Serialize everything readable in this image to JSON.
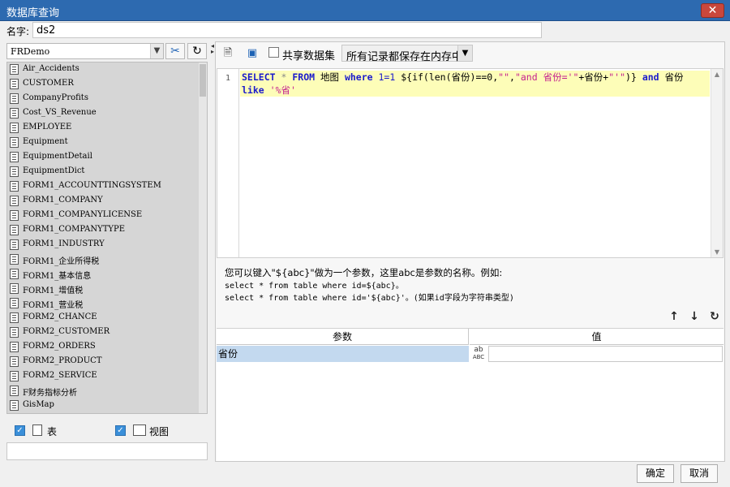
{
  "window": {
    "title": "数据库查询",
    "close_label": "✕"
  },
  "name_field": {
    "label": "名字:",
    "value": "ds2"
  },
  "left": {
    "connection": "FRDemo",
    "tables": [
      "Air_Accidents",
      "CUSTOMER",
      "CompanyProfits",
      "Cost_VS_Revenue",
      "EMPLOYEE",
      "Equipment",
      "EquipmentDetail",
      "EquipmentDict",
      "FORM1_ACCOUNTTINGSYSTEM",
      "FORM1_COMPANY",
      "FORM1_COMPANYLICENSE",
      "FORM1_COMPANYTYPE",
      "FORM1_INDUSTRY",
      "FORM1_企业所得税",
      "FORM1_基本信息",
      "FORM1_增值税",
      "FORM1_营业税",
      "FORM2_CHANCE",
      "FORM2_CUSTOMER",
      "FORM2_ORDERS",
      "FORM2_PRODUCT",
      "FORM2_SERVICE",
      "F财务指标分析",
      "GisMap"
    ],
    "filter_table_label": "表",
    "filter_view_label": "视图"
  },
  "right": {
    "share_label": "共享数据集",
    "storage_option": "所有记录都保存在内存中",
    "line_number": "1",
    "sql": {
      "t1": "SELECT",
      "t2": "*",
      "t3": "FROM",
      "t4": "地图",
      "t5": "where",
      "t6": "1=1",
      "t7": "${if(len(省份)==0,",
      "t8": "\"\"",
      "t9": ",",
      "t10": "\"and",
      "t11": "省份='\"",
      "t12": "+省份+",
      "t13": "\"'\"",
      "t14": ")}",
      "t15": "and",
      "t16": "省份",
      "t17": "like",
      "t18": "'%省'"
    },
    "hint_line1": "您可以键入\"${abc}\"做为一个参数，这里abc是参数的名称。例如:",
    "hint_line2": "select * from table where id=${abc}。",
    "hint_line3": "select * from table where id='${abc}'。(如果id字段为字符串类型)",
    "param_header_name": "参数",
    "param_header_value": "值",
    "param_rows": [
      {
        "name": "省份",
        "type_icon": "ABC",
        "value": ""
      }
    ]
  },
  "buttons": {
    "ok": "确定",
    "cancel": "取消"
  }
}
